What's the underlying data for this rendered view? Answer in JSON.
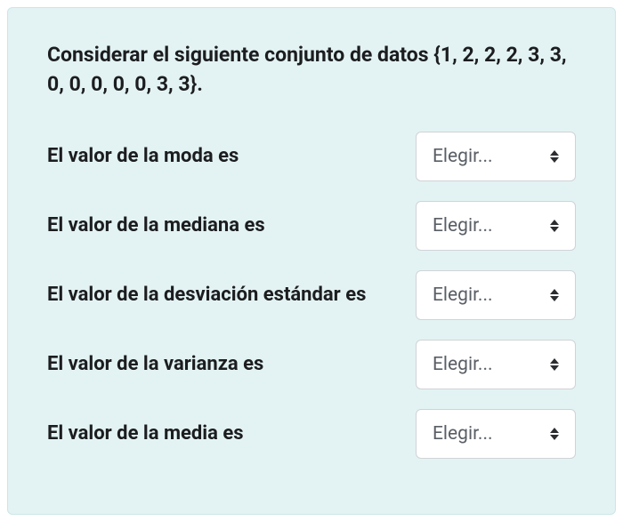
{
  "prompt": "Considerar el siguiente conjunto de datos {1, 2, 2, 2, 3, 3, 0, 0, 0, 0, 0, 3, 3}.",
  "select_placeholder": "Elegir...",
  "questions": [
    {
      "label": "El valor de la moda es"
    },
    {
      "label": "El valor de la mediana es"
    },
    {
      "label": "El valor de la desviación estándar es"
    },
    {
      "label": "El valor de la varianza es"
    },
    {
      "label": "El valor de la media es"
    }
  ]
}
